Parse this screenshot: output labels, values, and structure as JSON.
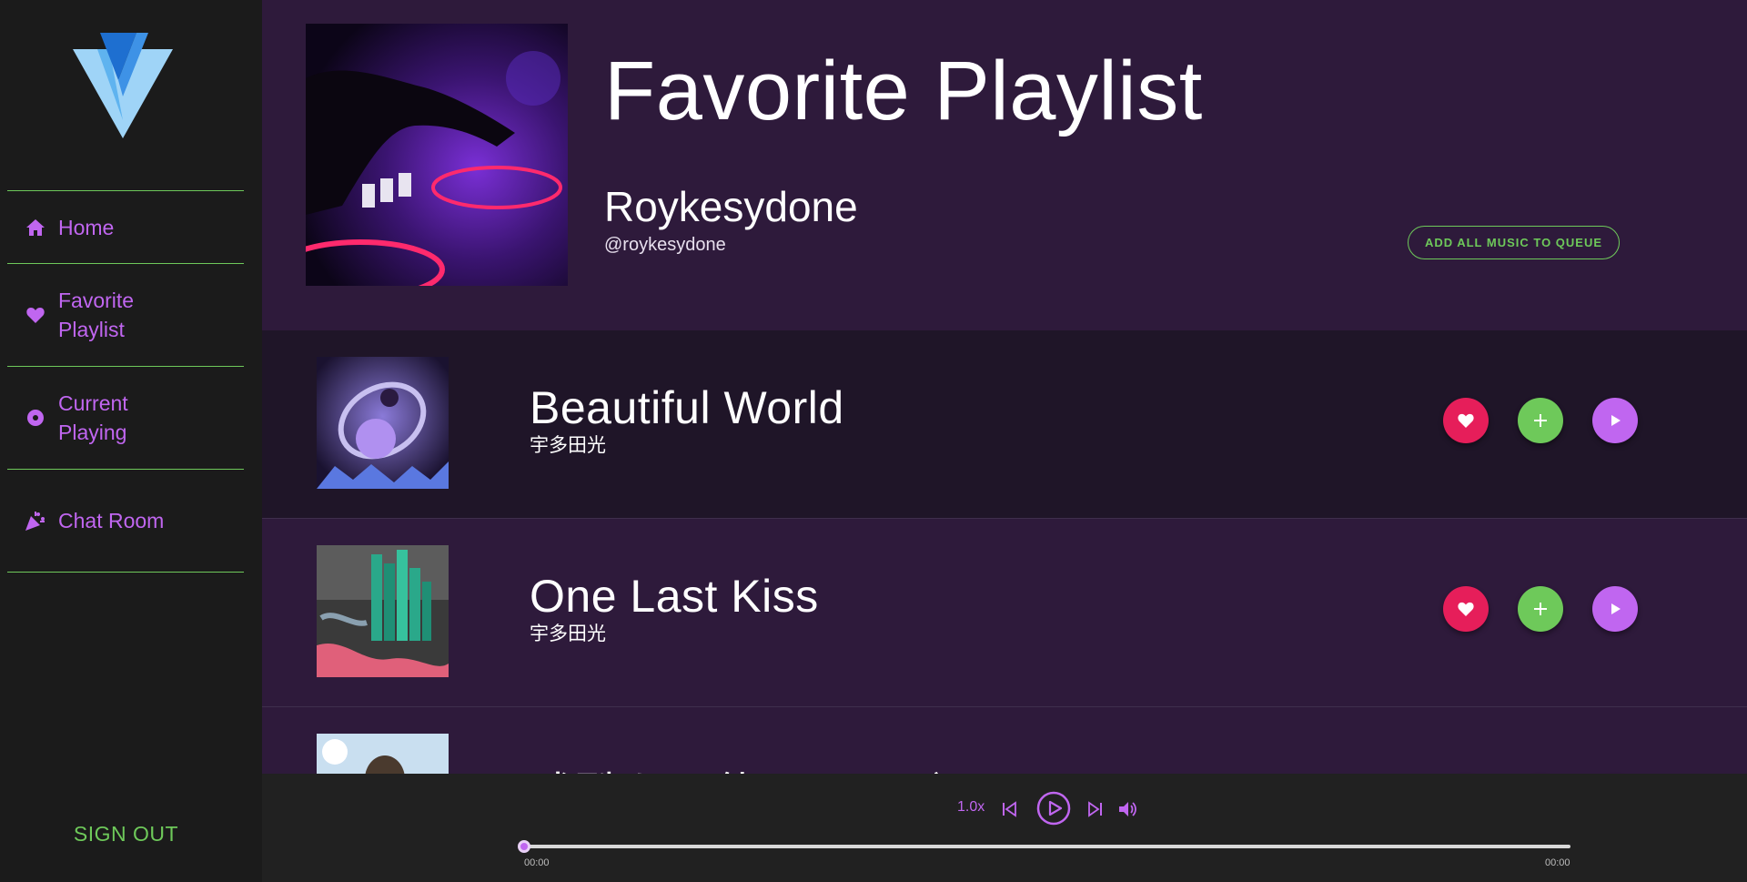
{
  "sidebar": {
    "logo_icon": "vuetify-v-logo",
    "items": [
      {
        "label": "Home",
        "icon": "home-icon"
      },
      {
        "label": "Favorite Playlist",
        "icon": "heart-icon"
      },
      {
        "label": "Current Playing",
        "icon": "disc-icon"
      },
      {
        "label": "Chat Room",
        "icon": "party-popper-icon"
      }
    ],
    "sign_out": "SIGN OUT"
  },
  "header": {
    "title": "Favorite Playlist",
    "user_name": "Roykesydone",
    "user_handle": "@roykesydone",
    "queue_button": "ADD ALL MUSIC TO QUEUE"
  },
  "tracks": [
    {
      "title": "Beautiful World",
      "artist": "宇多田光"
    },
    {
      "title": "One Last Kiss",
      "artist": "宇多田光"
    },
    {
      "title": "残酷な天使のテーゼ",
      "artist": ""
    }
  ],
  "player": {
    "speed": "1.0x",
    "current_time": "00:00",
    "total_time": "00:00",
    "progress": 0
  },
  "colors": {
    "accent_purple": "#c066f0",
    "accent_green": "#6ec95a",
    "like_pink": "#e61e5a",
    "sidebar_bg": "#1b1b1b",
    "main_bg": "#2e1a3b"
  }
}
